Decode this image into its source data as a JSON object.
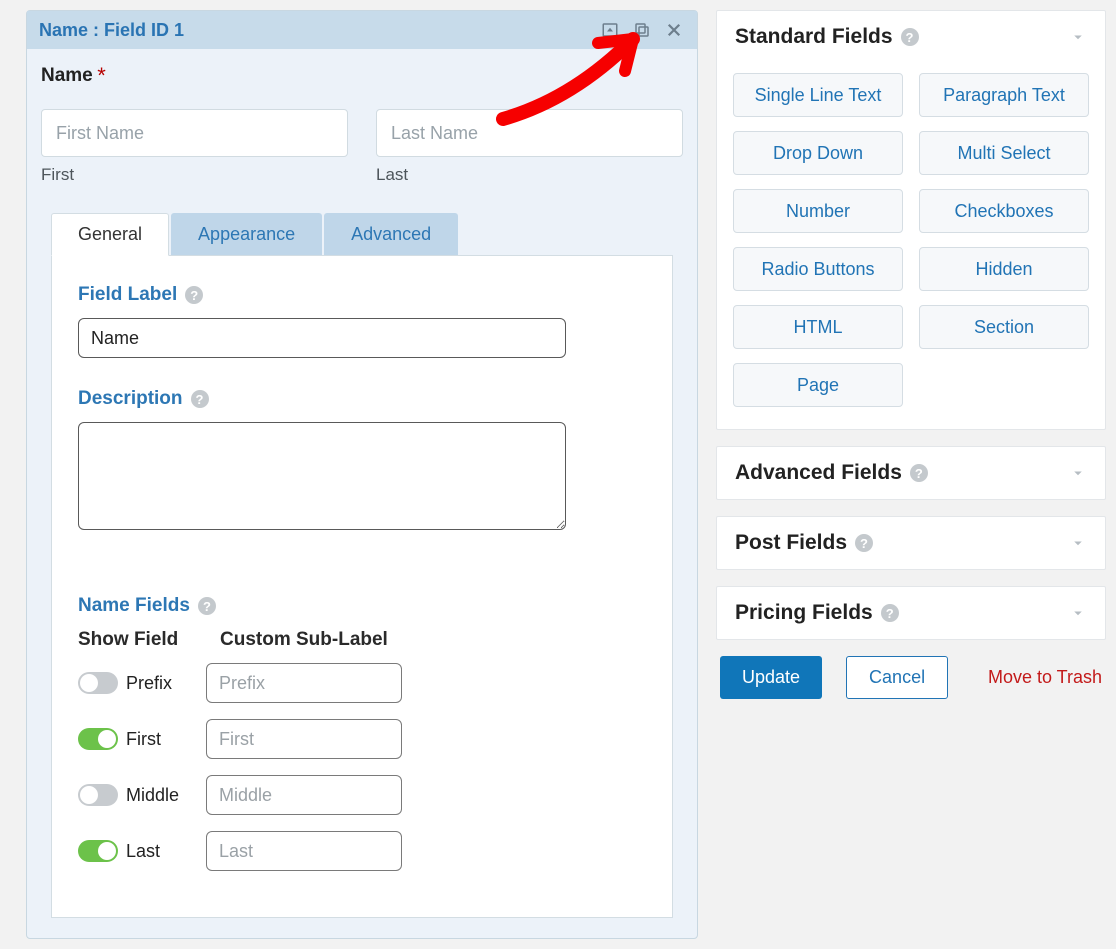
{
  "field": {
    "header_title": "Name : Field ID 1",
    "preview_label": "Name",
    "subfields": {
      "first": {
        "placeholder": "First Name",
        "sublabel": "First"
      },
      "last": {
        "placeholder": "Last Name",
        "sublabel": "Last"
      }
    }
  },
  "tabs": {
    "general": "General",
    "appearance": "Appearance",
    "advanced": "Advanced"
  },
  "general": {
    "field_label_heading": "Field Label",
    "field_label_value": "Name",
    "description_heading": "Description",
    "description_value": "",
    "name_fields_heading": "Name Fields",
    "col_show": "Show Field",
    "col_sub": "Custom Sub-Label",
    "rows": [
      {
        "key": "prefix",
        "label": "Prefix",
        "placeholder": "Prefix",
        "on": false
      },
      {
        "key": "first",
        "label": "First",
        "placeholder": "First",
        "on": true
      },
      {
        "key": "middle",
        "label": "Middle",
        "placeholder": "Middle",
        "on": false
      },
      {
        "key": "last",
        "label": "Last",
        "placeholder": "Last",
        "on": true
      }
    ]
  },
  "sidebar": {
    "standard": {
      "title": "Standard Fields",
      "items": [
        "Single Line Text",
        "Paragraph Text",
        "Drop Down",
        "Multi Select",
        "Number",
        "Checkboxes",
        "Radio Buttons",
        "Hidden",
        "HTML",
        "Section",
        "Page"
      ]
    },
    "advanced": {
      "title": "Advanced Fields"
    },
    "post": {
      "title": "Post Fields"
    },
    "pricing": {
      "title": "Pricing Fields"
    }
  },
  "actions": {
    "update": "Update",
    "cancel": "Cancel",
    "trash": "Move to Trash"
  }
}
